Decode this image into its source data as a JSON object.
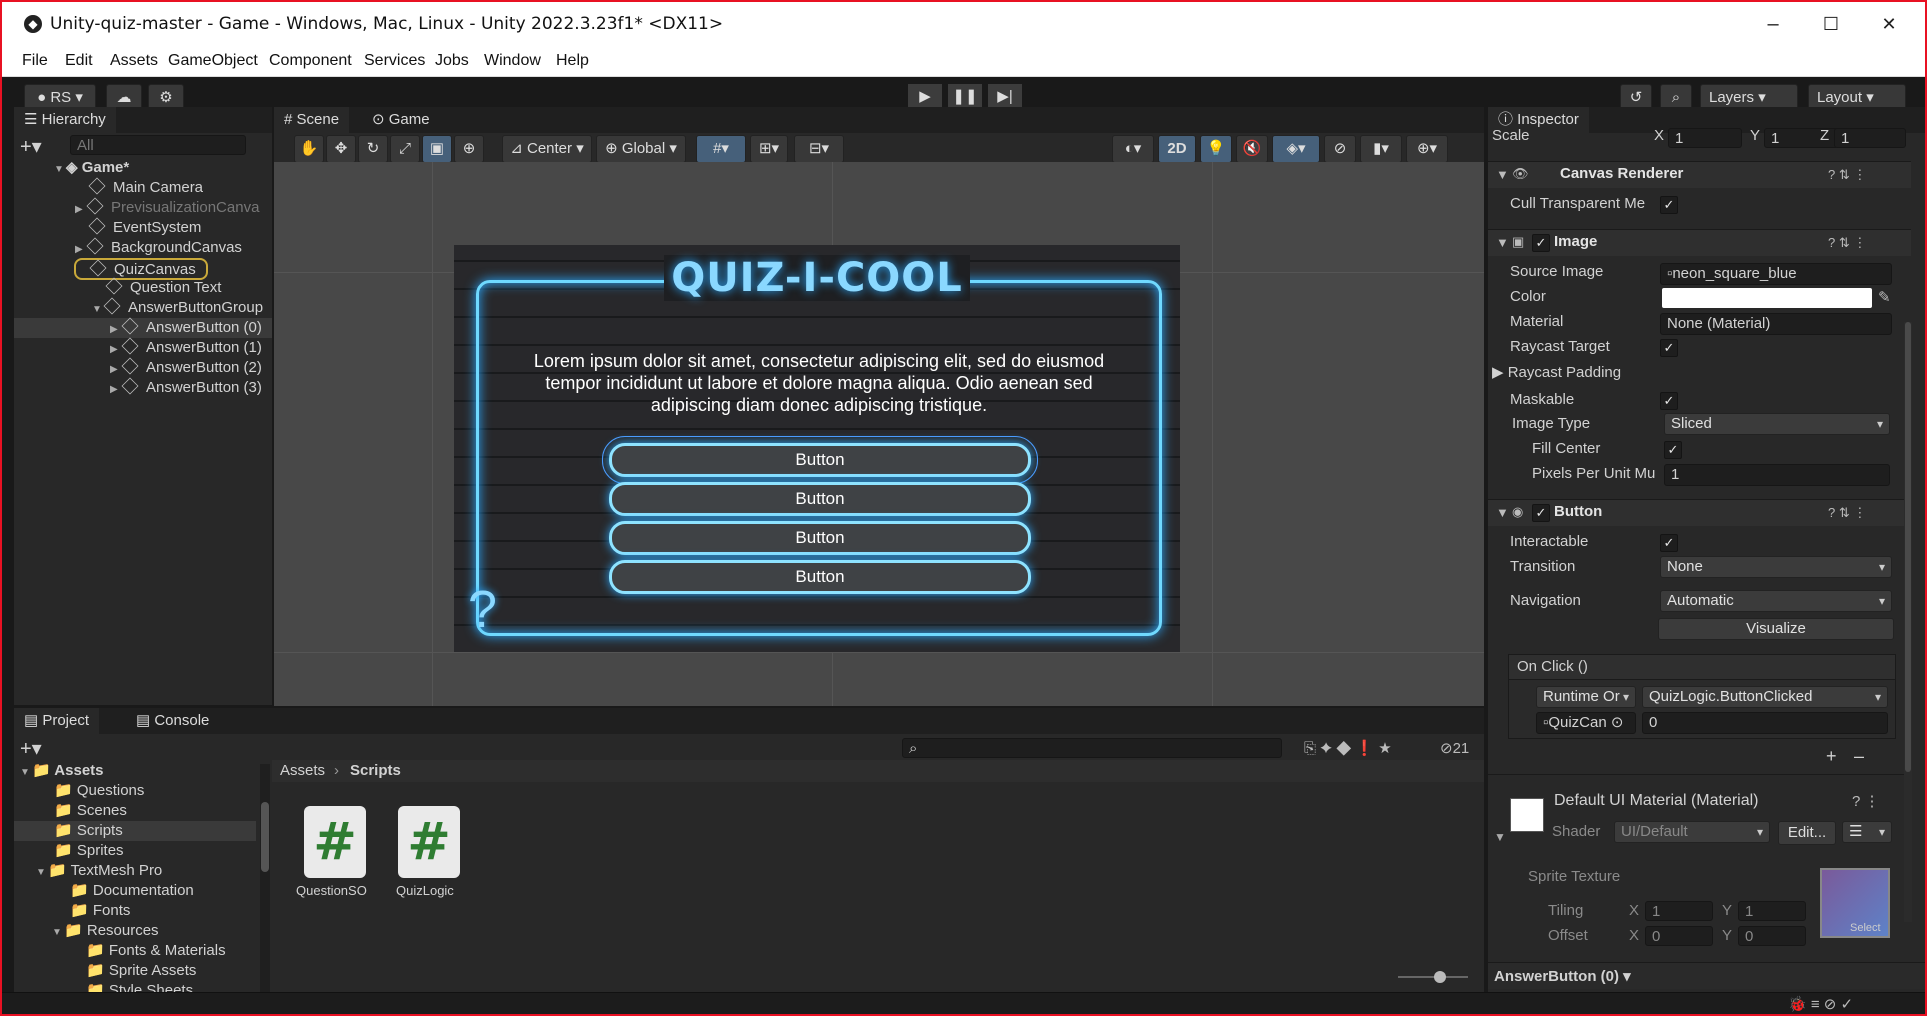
{
  "window": {
    "title": "Unity-quiz-master - Game - Windows, Mac, Linux - Unity 2022.3.23f1* <DX11>",
    "minimize": "–",
    "maximize": "☐",
    "close": "✕"
  },
  "menu": [
    "File",
    "Edit",
    "Assets",
    "GameObject",
    "Component",
    "Services",
    "Jobs",
    "Window",
    "Help"
  ],
  "toolbar": {
    "account": "RS",
    "layers": "Layers",
    "layout": "Layout"
  },
  "hierarchy": {
    "tab": "Hierarchy",
    "search_placeholder": "All",
    "root": "Game*",
    "items": [
      "Main Camera",
      "PrevisualizationCanva",
      "EventSystem",
      "BackgroundCanvas",
      "QuizCanvas",
      "Question Text",
      "AnswerButtonGroup",
      "AnswerButton (0)",
      "AnswerButton (1)",
      "AnswerButton (2)",
      "AnswerButton (3)"
    ]
  },
  "scene": {
    "tabs": [
      "Scene",
      "Game"
    ],
    "pivot": "Center",
    "space": "Global",
    "mode2d": "2D",
    "quiz_title": "QUIZ-I-COOL",
    "question": "Lorem ipsum dolor sit amet, consectetur adipiscing elit, sed do eiusmod tempor incididunt ut labore et dolore magna aliqua. Odio aenean sed adipiscing diam donec adipiscing tristique.",
    "buttons": [
      "Button",
      "Button",
      "Button",
      "Button"
    ],
    "question_mark": "?"
  },
  "project": {
    "tabs": [
      "Project",
      "Console"
    ],
    "hidden_count": "21",
    "tree": [
      "Assets",
      "Questions",
      "Scenes",
      "Scripts",
      "Sprites",
      "TextMesh Pro",
      "Documentation",
      "Fonts",
      "Resources",
      "Fonts & Materials",
      "Sprite Assets",
      "Style Sheets"
    ],
    "breadcrumb": [
      "Assets",
      "Scripts"
    ],
    "files": [
      "QuestionSO",
      "QuizLogic"
    ]
  },
  "inspector": {
    "tab": "Inspector",
    "scale_label": "Scale",
    "scale": {
      "x": "1",
      "y": "1",
      "z": "1"
    },
    "canvas_renderer": "Canvas Renderer",
    "cull_label": "Cull Transparent Me",
    "image": "Image",
    "source_image_label": "Source Image",
    "source_image": "neon_square_blue",
    "color_label": "Color",
    "material_label": "Material",
    "material": "None (Material)",
    "raycast_target": "Raycast Target",
    "raycast_padding": "Raycast Padding",
    "maskable": "Maskable",
    "image_type_label": "Image Type",
    "image_type": "Sliced",
    "fill_center": "Fill Center",
    "ppu_label": "Pixels Per Unit Mu",
    "ppu": "1",
    "button": "Button",
    "interactable": "Interactable",
    "transition_label": "Transition",
    "transition": "None",
    "navigation_label": "Navigation",
    "navigation": "Automatic",
    "visualize": "Visualize",
    "onclick": "On Click ()",
    "runtime": "Runtime Or",
    "function": "QuizLogic.ButtonClicked",
    "target": "QuizCan",
    "arg": "0",
    "plus": "+",
    "minus": "–",
    "default_material": "Default UI Material (Material)",
    "shader_label": "Shader",
    "shader": "UI/Default",
    "edit": "Edit...",
    "sprite_texture": "Sprite Texture",
    "tiling": "Tiling",
    "offset": "Offset",
    "tiling_x": "1",
    "tiling_y": "1",
    "offset_x": "0",
    "offset_y": "0",
    "x": "X",
    "y": "Y",
    "z": "Z",
    "select": "Select",
    "footer": "AnswerButton (0)"
  }
}
